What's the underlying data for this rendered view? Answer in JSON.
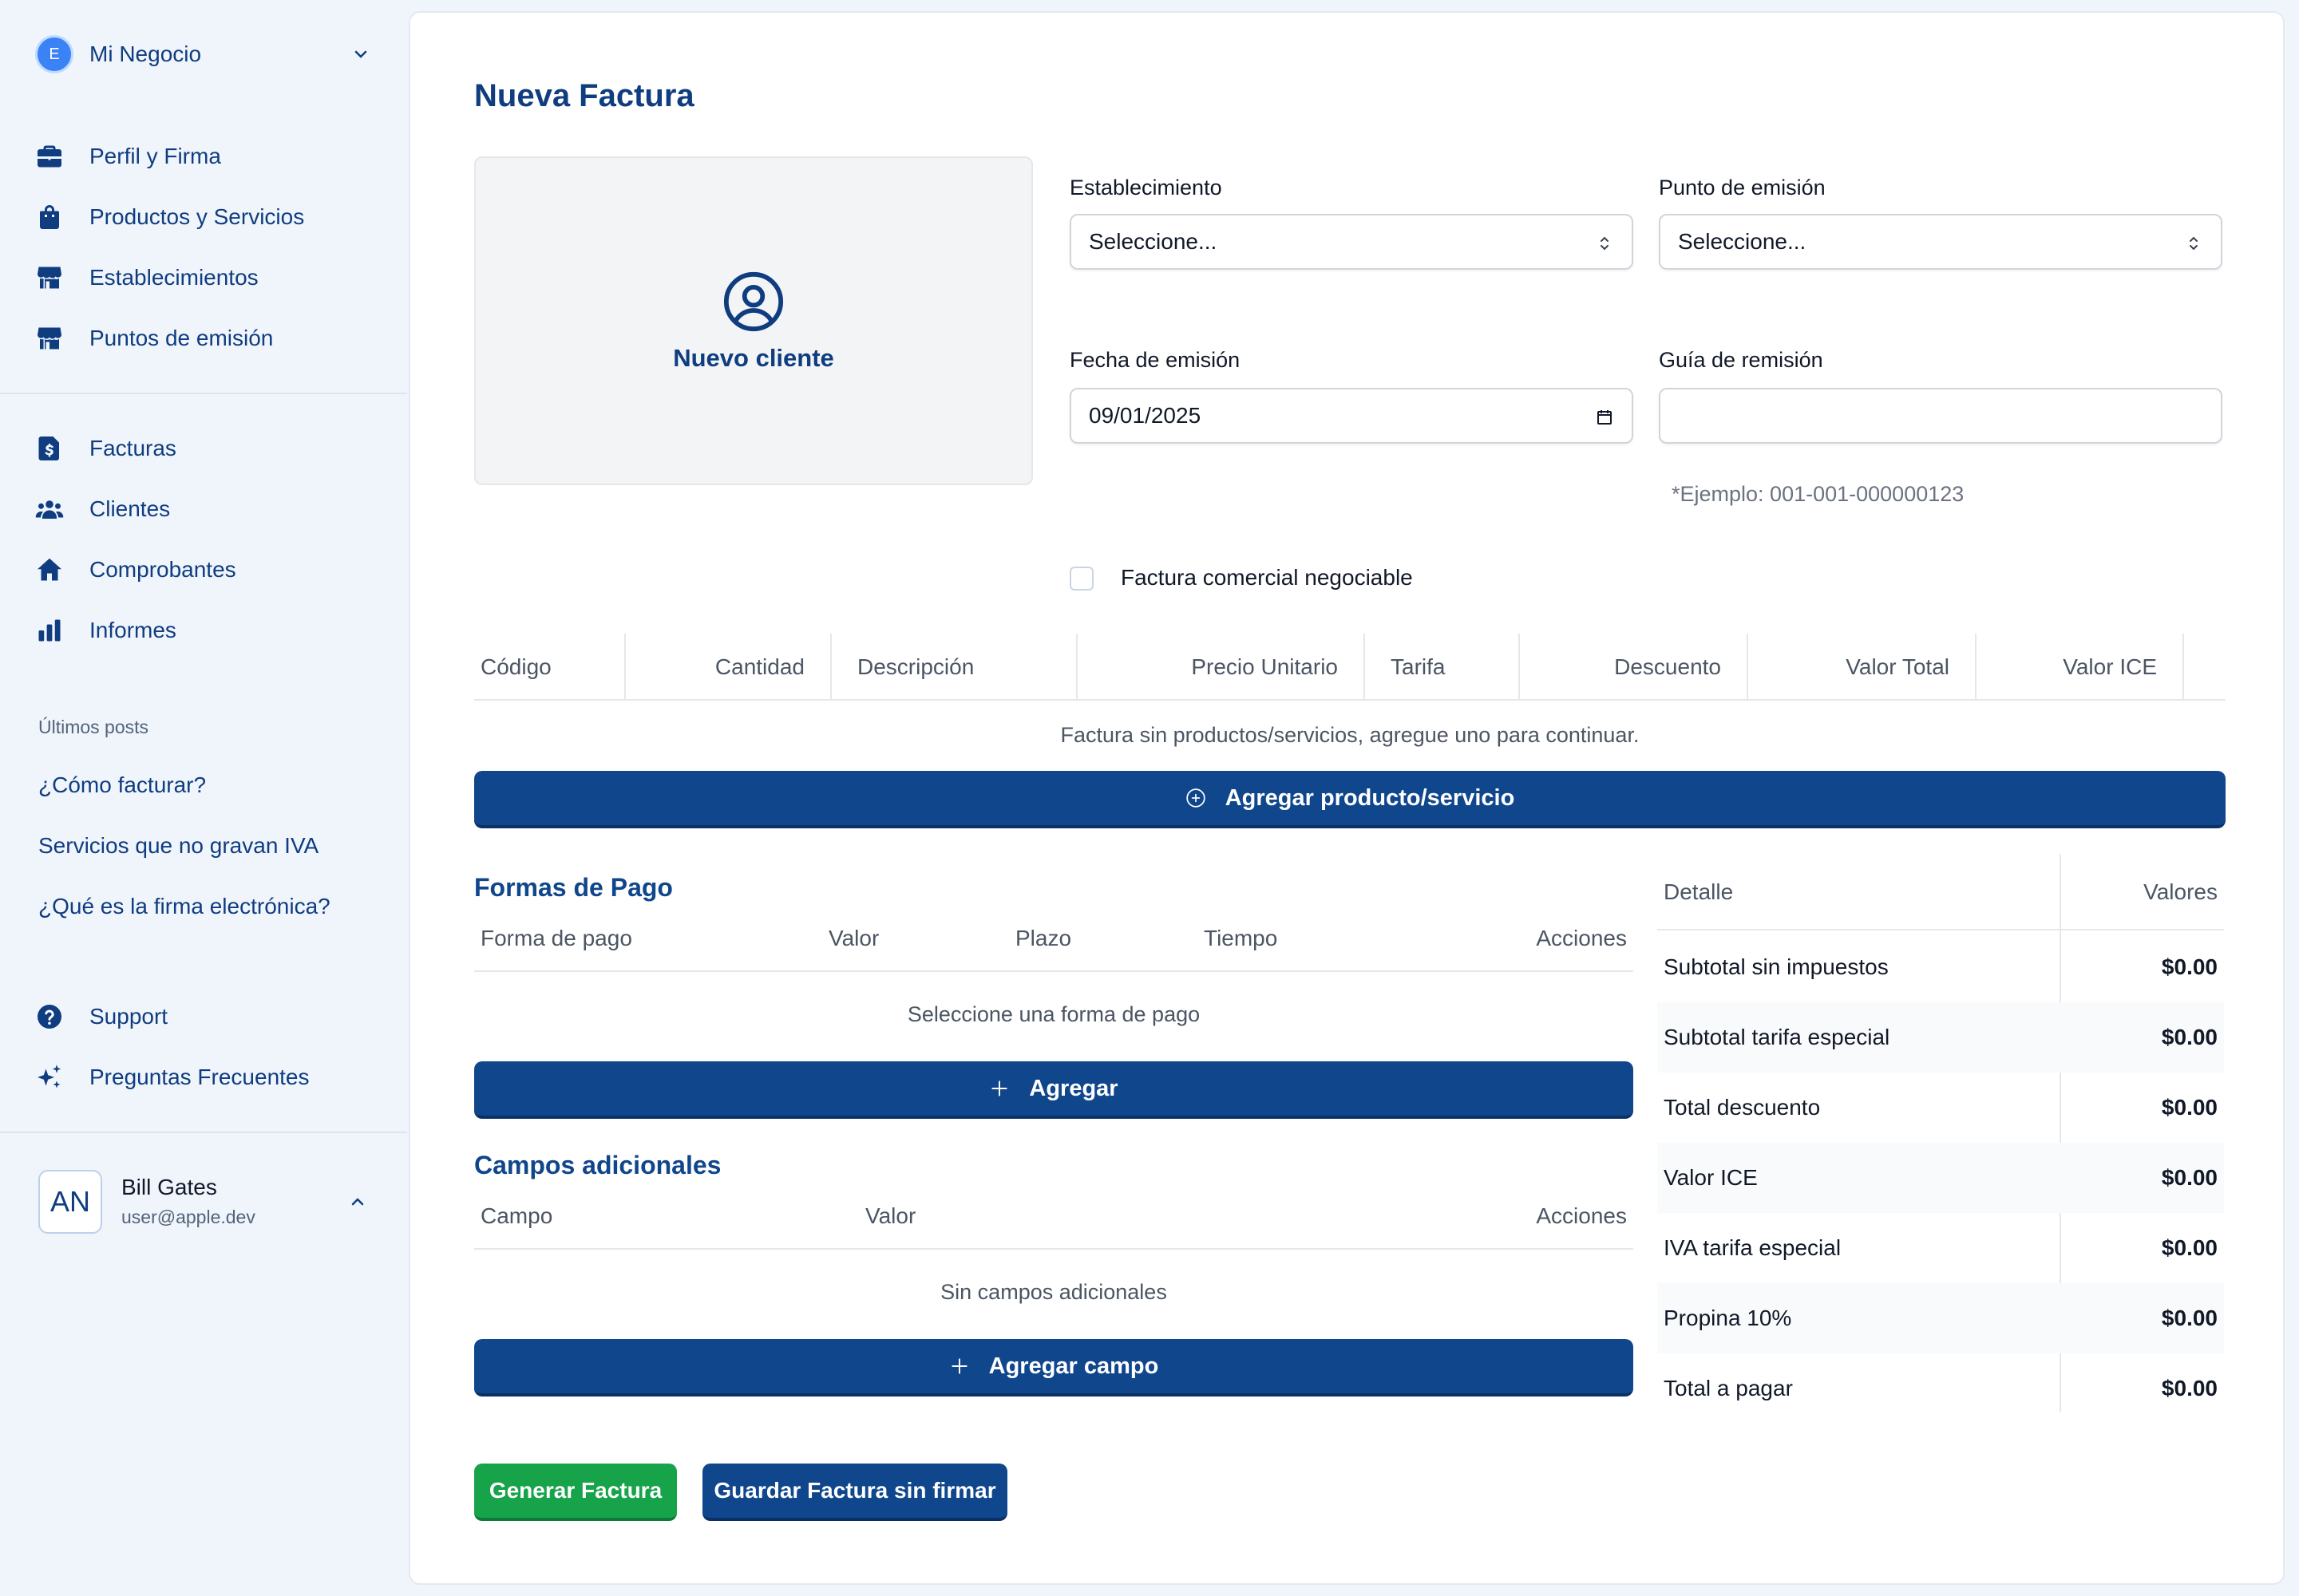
{
  "sidebar": {
    "business": {
      "initial": "E",
      "name": "Mi Negocio"
    },
    "nav_top": [
      {
        "label": "Perfil y Firma",
        "icon": "briefcase-icon"
      },
      {
        "label": "Productos y Servicios",
        "icon": "shopping-bag-icon"
      },
      {
        "label": "Establecimientos",
        "icon": "store-icon"
      },
      {
        "label": "Puntos de emisión",
        "icon": "store-icon"
      }
    ],
    "nav_main": [
      {
        "label": "Facturas",
        "icon": "invoice-dollar-icon"
      },
      {
        "label": "Clientes",
        "icon": "users-icon"
      },
      {
        "label": "Comprobantes",
        "icon": "home-icon"
      },
      {
        "label": "Informes",
        "icon": "bar-chart-icon"
      }
    ],
    "posts_title": "Últimos posts",
    "posts": [
      "¿Cómo facturar?",
      "Servicios que no gravan IVA",
      "¿Qué es la firma electrónica?"
    ],
    "nav_bottom": [
      {
        "label": "Support",
        "icon": "question-circle-icon"
      },
      {
        "label": "Preguntas Frecuentes",
        "icon": "sparkles-icon"
      }
    ],
    "user": {
      "initials": "AN",
      "name": "Bill Gates",
      "email": "user@apple.dev"
    }
  },
  "main": {
    "title": "Nueva Factura",
    "new_client_label": "Nuevo cliente",
    "establecimiento": {
      "label": "Establecimiento",
      "value": "Seleccione..."
    },
    "punto_emision": {
      "label": "Punto de emisión",
      "value": "Seleccione..."
    },
    "fecha_emision": {
      "label": "Fecha de emisión",
      "value": "09/01/2025"
    },
    "guia_remision": {
      "label": "Guía de remisión",
      "value": "",
      "hint": "*Ejemplo: 001-001-000000123"
    },
    "negociable_label": "Factura comercial negociable",
    "items_table": {
      "columns": [
        "Código",
        "Cantidad",
        "Descripción",
        "Precio Unitario",
        "Tarifa",
        "Descuento",
        "Valor Total",
        "Valor ICE"
      ],
      "empty_message": "Factura sin productos/servicios, agregue uno para continuar.",
      "add_button": "Agregar producto/servicio"
    },
    "payments": {
      "title": "Formas de Pago",
      "columns": [
        "Forma de pago",
        "Valor",
        "Plazo",
        "Tiempo",
        "Acciones"
      ],
      "empty_message": "Seleccione una forma de pago",
      "add_button": "Agregar"
    },
    "extra_fields": {
      "title": "Campos adicionales",
      "columns": [
        "Campo",
        "Valor",
        "Acciones"
      ],
      "empty_message": "Sin campos adicionales",
      "add_button": "Agregar campo"
    },
    "summary": {
      "header_detail": "Detalle",
      "header_values": "Valores",
      "rows": [
        {
          "label": "Subtotal sin impuestos",
          "value": "$0.00"
        },
        {
          "label": "Subtotal tarifa especial",
          "value": "$0.00"
        },
        {
          "label": "Total descuento",
          "value": "$0.00"
        },
        {
          "label": "Valor ICE",
          "value": "$0.00"
        },
        {
          "label": "IVA tarifa especial",
          "value": "$0.00"
        },
        {
          "label": "Propina 10%",
          "value": "$0.00"
        },
        {
          "label": "Total a pagar",
          "value": "$0.00"
        }
      ]
    },
    "actions": {
      "generate": "Generar Factura",
      "save_unsigned": "Guardar Factura sin firmar"
    }
  },
  "colors": {
    "brand": "#0f468c",
    "success": "#16a34a",
    "sidebar_bg": "#f0f5fc"
  }
}
